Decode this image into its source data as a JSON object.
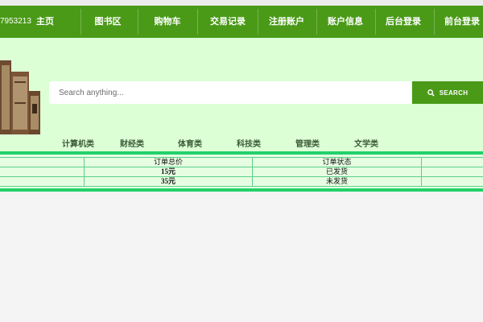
{
  "header": {
    "phone": "7953213",
    "nav": [
      {
        "label": "主页",
        "id": "home"
      },
      {
        "label": "图书区",
        "id": "books"
      },
      {
        "label": "购物车",
        "id": "cart"
      },
      {
        "label": "交易记录",
        "id": "orders"
      },
      {
        "label": "注册账户",
        "id": "register"
      },
      {
        "label": "账户信息",
        "id": "account"
      },
      {
        "label": "后台登录",
        "id": "admin-login"
      },
      {
        "label": "前台登录",
        "id": "user-login"
      }
    ]
  },
  "search": {
    "placeholder": "Search anything...",
    "button_label": "SEARCH"
  },
  "categories": [
    "计算机类",
    "财经类",
    "体育类",
    "科技类",
    "管理类",
    "文学类"
  ],
  "orders_table": {
    "headers": [
      "",
      "订单总价",
      "订单状态",
      ""
    ],
    "rows": [
      [
        "",
        "15元",
        "已发货",
        ""
      ],
      [
        "",
        "35元",
        "未发货",
        ""
      ]
    ]
  },
  "colors": {
    "nav_bg": "#4a9a18",
    "hero_bg": "#dcffd6",
    "separator": "#22d16a"
  }
}
